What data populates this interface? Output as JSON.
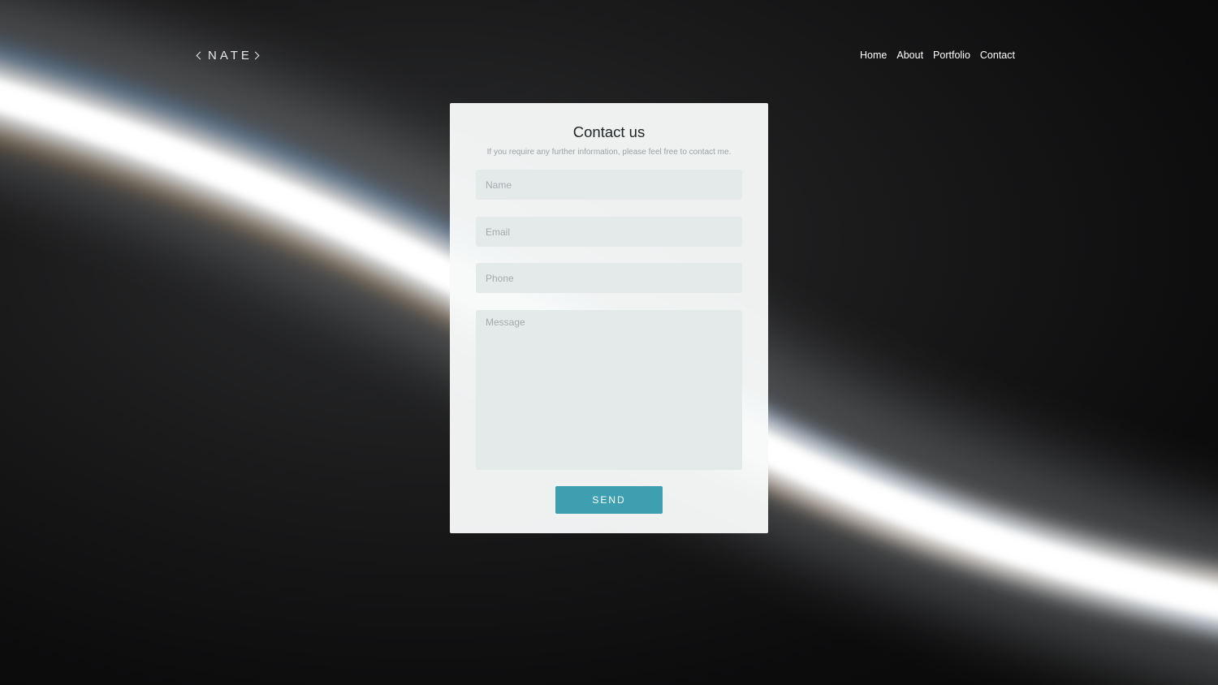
{
  "header": {
    "logo_text": "NATE",
    "nav": [
      {
        "label": "Home"
      },
      {
        "label": "About"
      },
      {
        "label": "Portfolio"
      },
      {
        "label": "Contact"
      }
    ]
  },
  "contact_form": {
    "title": "Contact us",
    "subtitle": "If you require any further information, please feel free to contact me.",
    "name_placeholder": "Name",
    "email_placeholder": "Email",
    "phone_placeholder": "Phone",
    "message_placeholder": "Message",
    "send_label": "SEND"
  },
  "colors": {
    "accent": "#3e9fb0",
    "background": "#0d0d0e",
    "card": "#f8fafa",
    "field": "#e4eae9"
  },
  "icons": {
    "logo_left": "chevron-left-icon",
    "logo_right": "chevron-right-icon"
  }
}
